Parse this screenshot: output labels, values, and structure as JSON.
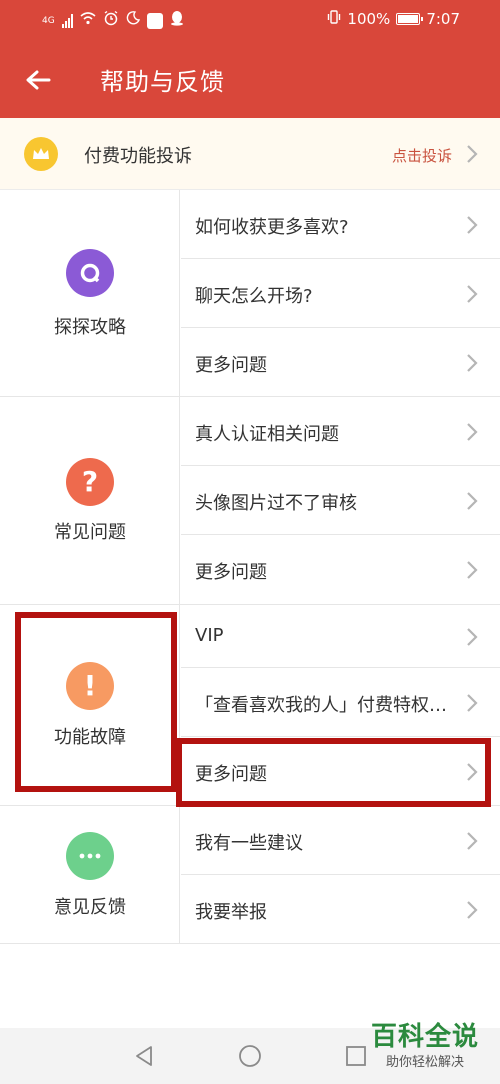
{
  "status_bar": {
    "network": "4G",
    "battery_text": "100%",
    "time": "7:07",
    "icons": [
      "signal-icon",
      "wifi-icon",
      "alarm-icon",
      "moon-icon",
      "app-notification-icon",
      "qq-icon",
      "vibrate-icon",
      "battery-icon"
    ]
  },
  "header": {
    "title": "帮助与反馈",
    "back_icon": "back-arrow-icon"
  },
  "complaint": {
    "label": "付费功能投诉",
    "action": "点击投诉",
    "icon": "crown-icon"
  },
  "sections": [
    {
      "label": "探探攻略",
      "icon": "guide-icon",
      "color": "#8b5ad6",
      "items": [
        "如何收获更多喜欢?",
        "聊天怎么开场?",
        "更多问题"
      ]
    },
    {
      "label": "常见问题",
      "icon": "question-icon",
      "color": "#ee6a4d",
      "items": [
        "真人认证相关问题",
        "头像图片过不了审核",
        "更多问题"
      ]
    },
    {
      "label": "功能故障",
      "icon": "exclamation-icon",
      "color": "#f79a62",
      "items": [
        "VIP",
        "「查看喜欢我的人」付费特权的使用",
        "更多问题"
      ]
    },
    {
      "label": "意见反馈",
      "icon": "more-dots-icon",
      "color": "#6dd08c",
      "items": [
        "我有一些建议",
        "我要举报"
      ]
    }
  ],
  "watermark": {
    "title": "百科全说",
    "subtitle": "助你轻松解决"
  },
  "colors": {
    "brand": "#d9473a",
    "highlight": "#b3120f",
    "complaint_action": "#c9533f"
  }
}
